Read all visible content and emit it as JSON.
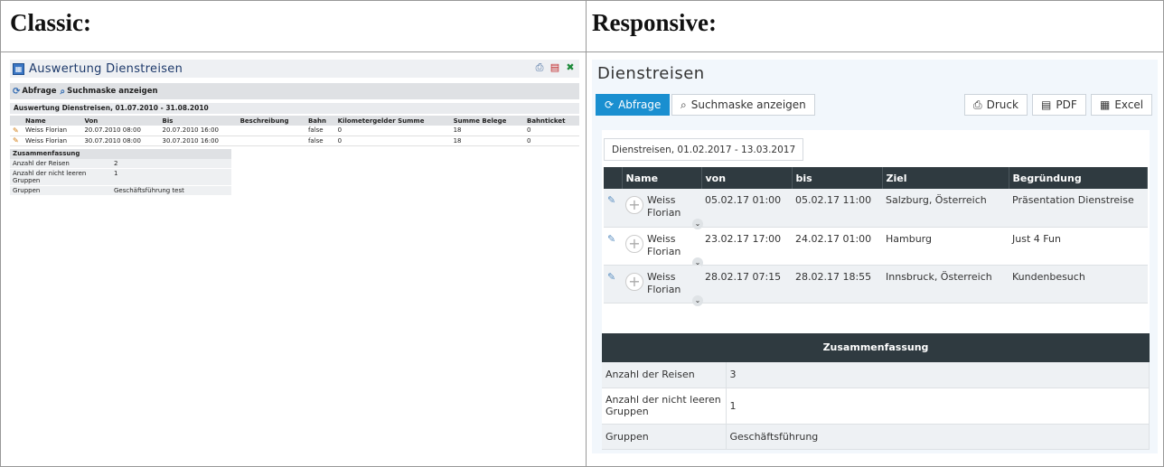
{
  "labels": {
    "classic": "Classic:",
    "responsive": "Responsive:"
  },
  "classic": {
    "title": "Auswertung Dienstreisen",
    "toolbar": {
      "query": "Abfrage",
      "search_mask": "Suchmaske anzeigen"
    },
    "subtitle": "Auswertung Dienstreisen, 01.07.2010 - 31.08.2010",
    "columns": [
      "Name",
      "Von",
      "Bis",
      "Beschreibung",
      "Bahn",
      "Kilometergelder Summe",
      "Summe Belege",
      "Bahnticket"
    ],
    "rows": [
      [
        "Weiss Florian",
        "20.07.2010 08:00",
        "20.07.2010 16:00",
        "",
        "false",
        "0",
        "18",
        "0"
      ],
      [
        "Weiss Florian",
        "30.07.2010 08:00",
        "30.07.2010 16:00",
        "",
        "false",
        "0",
        "18",
        "0"
      ]
    ],
    "summary": {
      "title": "Zusammenfassung",
      "rows": [
        [
          "Anzahl der Reisen",
          "2"
        ],
        [
          "Anzahl der nicht leeren Gruppen",
          "1"
        ],
        [
          "Gruppen",
          "Geschäftsführung test"
        ]
      ]
    }
  },
  "responsive": {
    "title": "Dienstreisen",
    "buttons": {
      "query": "Abfrage",
      "search_mask": "Suchmaske anzeigen",
      "print": "Druck",
      "pdf": "PDF",
      "excel": "Excel"
    },
    "date_range": "Dienstreisen, 01.02.2017 - 13.03.2017",
    "columns": [
      "Name",
      "von",
      "bis",
      "Ziel",
      "Begründung"
    ],
    "rows": [
      {
        "first": "Weiss",
        "last": "Florian",
        "von": "05.02.17 01:00",
        "bis": "05.02.17 11:00",
        "ziel": "Salzburg, Österreich",
        "grund": "Präsentation Dienstreise"
      },
      {
        "first": "Weiss",
        "last": "Florian",
        "von": "23.02.17 17:00",
        "bis": "24.02.17 01:00",
        "ziel": "Hamburg",
        "grund": "Just 4 Fun"
      },
      {
        "first": "Weiss",
        "last": "Florian",
        "von": "28.02.17 07:15",
        "bis": "28.02.17 18:55",
        "ziel": "Innsbruck, Österreich",
        "grund": "Kundenbesuch"
      }
    ],
    "summary": {
      "title": "Zusammenfassung",
      "rows": [
        [
          "Anzahl der Reisen",
          "3"
        ],
        [
          "Anzahl der nicht leeren Gruppen",
          "1"
        ],
        [
          "Gruppen",
          "Geschäftsführung"
        ]
      ]
    }
  },
  "colors": {
    "primary": "#1a8fd0",
    "table_header": "#2f3a40"
  }
}
